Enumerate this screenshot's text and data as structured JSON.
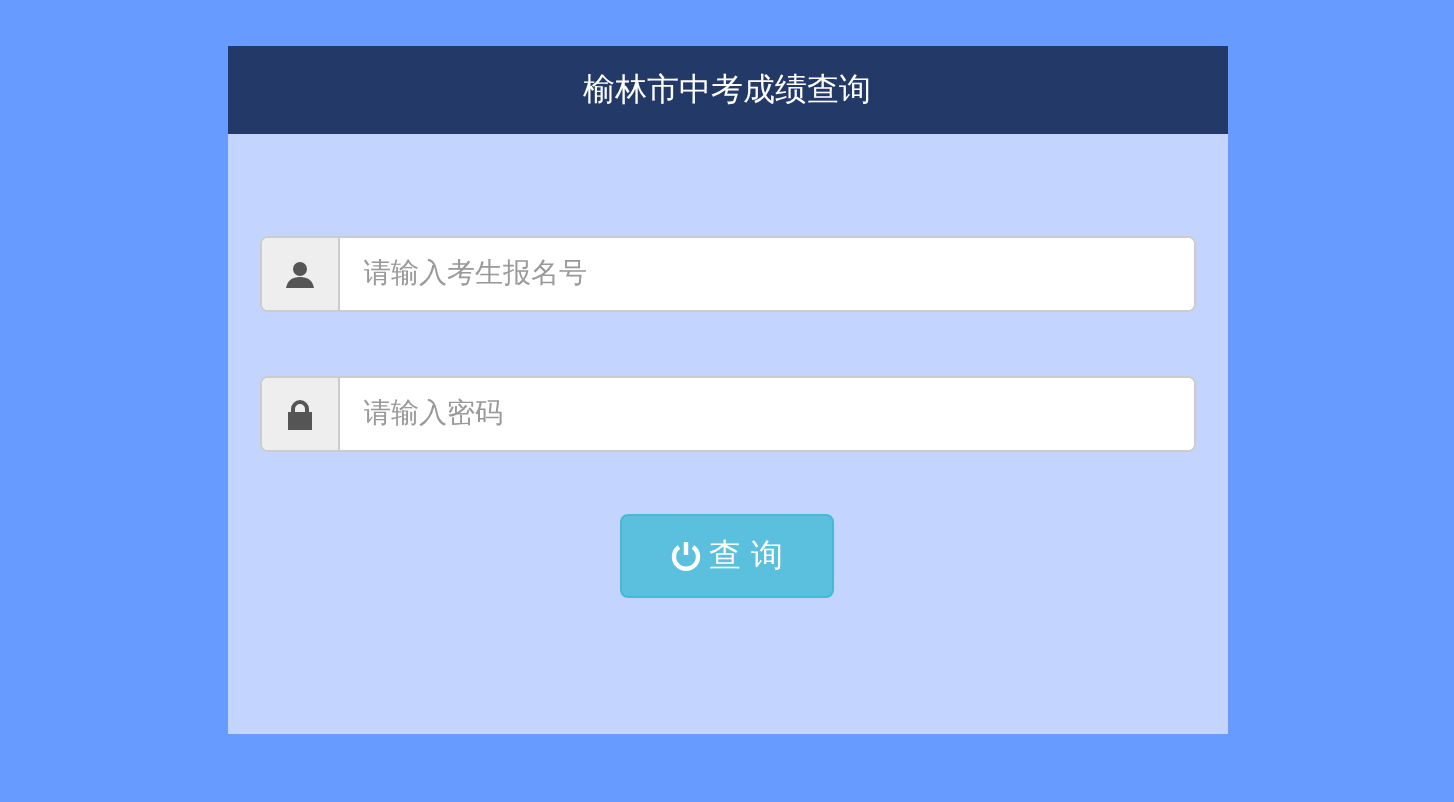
{
  "header": {
    "title": "榆林市中考成绩查询"
  },
  "fields": [
    {
      "kind": "user",
      "placeholder": "请输入考生报名号"
    },
    {
      "kind": "password",
      "placeholder": "请输入密码"
    }
  ],
  "submit": {
    "label": "查 询"
  }
}
